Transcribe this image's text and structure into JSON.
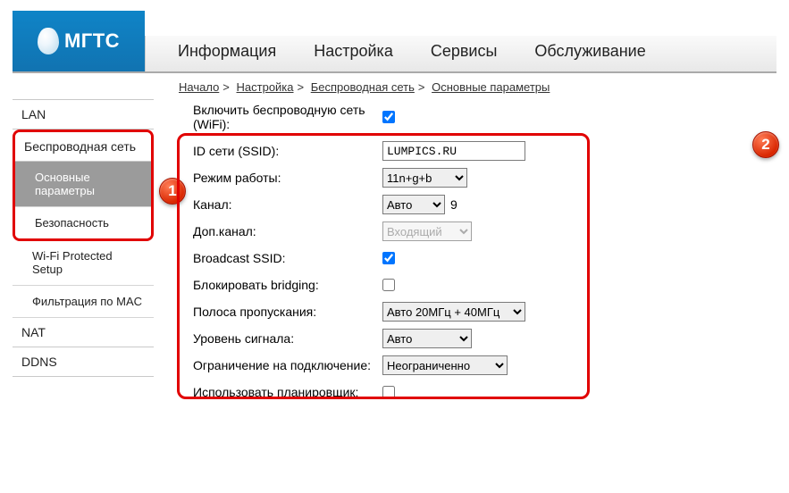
{
  "logo_text": "МГТС",
  "topnav": [
    "Информация",
    "Настройка",
    "Сервисы",
    "Обслуживание"
  ],
  "breadcrumb": [
    "Начало",
    "Настройка",
    "Беспроводная сеть",
    "Основные параметры"
  ],
  "sidebar": {
    "lan": "LAN",
    "wireless": "Беспроводная сеть",
    "subs": [
      "Основные параметры",
      "Безопасность",
      "Wi-Fi Protected Setup",
      "Фильтрация по MAC"
    ],
    "nat": "NAT",
    "ddns": "DDNS"
  },
  "badges": {
    "one": "1",
    "two": "2"
  },
  "form": {
    "enable_label": "Включить беспроводную сеть (WiFi):",
    "enable_checked": true,
    "ssid_label": "ID сети (SSID):",
    "ssid_value": "LUMPICS.RU",
    "mode_label": "Режим работы:",
    "mode_value": "11n+g+b",
    "channel_label": "Канал:",
    "channel_value": "Авто",
    "channel_num": "9",
    "subchannel_label": "Доп.канал:",
    "subchannel_value": "Входящий",
    "broadcast_label": "Broadcast SSID:",
    "broadcast_checked": true,
    "block_bridge_label": "Блокировать bridging:",
    "block_bridge_checked": false,
    "bandwidth_label": "Полоса пропускания:",
    "bandwidth_value": "Авто 20МГц + 40МГц",
    "signal_label": "Уровень сигнала:",
    "signal_value": "Авто",
    "limit_label": "Ограничение на подключение:",
    "limit_value": "Неограниченно",
    "scheduler_label": "Использовать планировщик:",
    "scheduler_checked": false
  }
}
